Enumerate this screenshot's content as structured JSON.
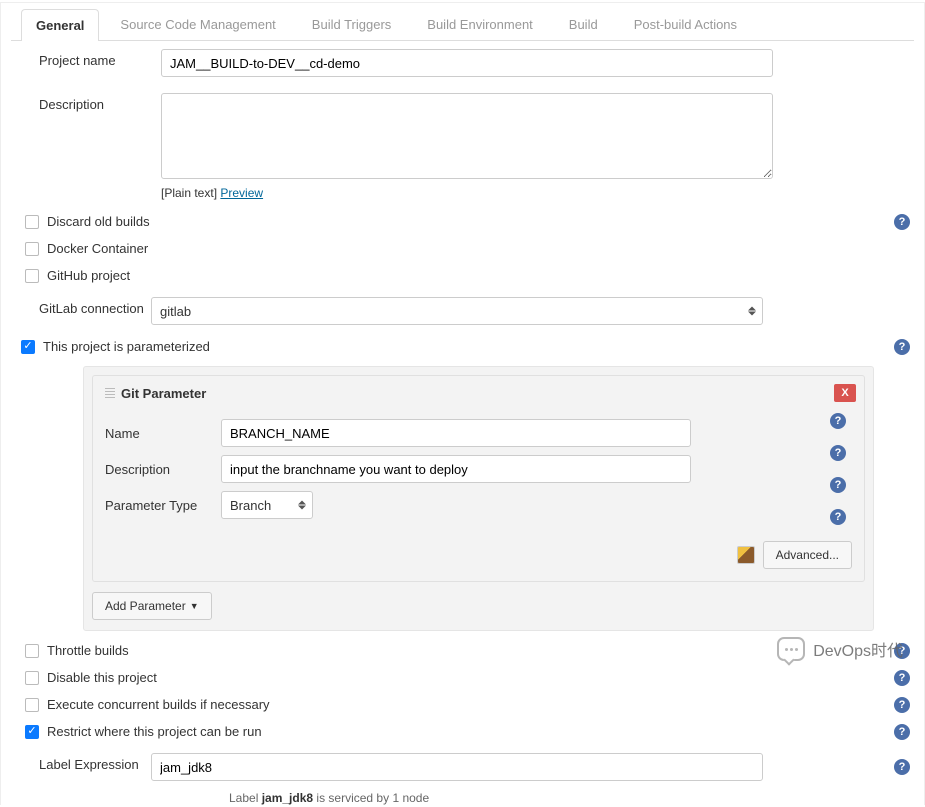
{
  "tabs": {
    "general": "General",
    "scm": "Source Code Management",
    "triggers": "Build Triggers",
    "env": "Build Environment",
    "build": "Build",
    "post": "Post-build Actions"
  },
  "form": {
    "project_name_label": "Project name",
    "project_name_value": "JAM__BUILD-to-DEV__cd-demo",
    "description_label": "Description",
    "description_value": "",
    "plain_text": "[Plain text]",
    "preview": "Preview",
    "gitlab_connection_label": "GitLab connection",
    "gitlab_connection_value": "gitlab",
    "label_expression_label": "Label Expression",
    "label_expression_value": "jam_jdk8"
  },
  "checks": {
    "discard": "Discard old builds",
    "docker": "Docker Container",
    "github": "GitHub project",
    "parameterized": "This project is parameterized",
    "throttle": "Throttle builds",
    "disable": "Disable this project",
    "concurrent": "Execute concurrent builds if necessary",
    "restrict": "Restrict where this project can be run"
  },
  "param": {
    "section_title": "Git Parameter",
    "name_label": "Name",
    "name_value": "BRANCH_NAME",
    "desc_label": "Description",
    "desc_value": "input the branchname you want to deploy",
    "type_label": "Parameter Type",
    "type_value": "Branch",
    "advanced": "Advanced...",
    "close": "X",
    "add_parameter": "Add Parameter"
  },
  "footer": {
    "prefix": "Label ",
    "label": "jam_jdk8",
    "suffix": " is serviced by 1 node"
  },
  "watermark": "DevOps时代"
}
